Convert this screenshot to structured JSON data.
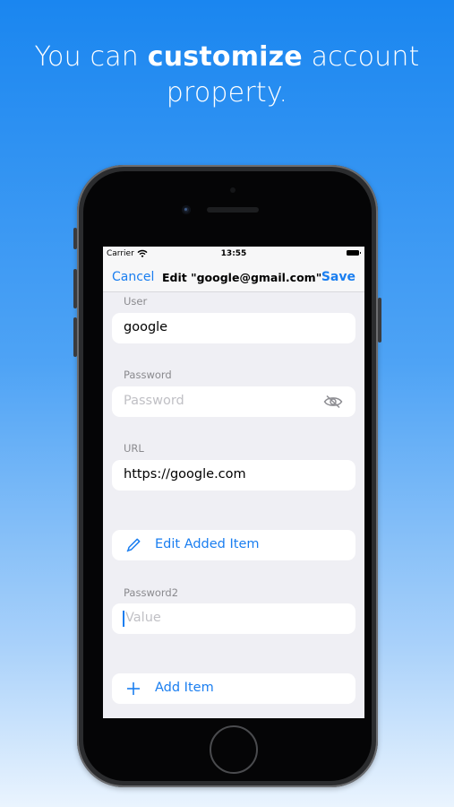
{
  "headline": {
    "prefix": "You can ",
    "bold": "customize",
    "suffix": " account property."
  },
  "status": {
    "carrier": "Carrier",
    "time": "13:55"
  },
  "nav": {
    "cancel": "Cancel",
    "title": "Edit \"google@gmail.com\"",
    "save": "Save"
  },
  "form": {
    "user_label": "User",
    "user_value": "google",
    "password_label": "Password",
    "password_placeholder": "Password",
    "url_label": "URL",
    "url_value": "https://google.com",
    "edit_added_item": "Edit Added Item",
    "password2_label": "Password2",
    "password2_placeholder": "Value",
    "add_item": "Add Item"
  },
  "icons": {
    "wifi": "wifi-icon",
    "battery": "battery-icon",
    "eye": "eye-slash-icon",
    "pencil": "pencil-icon",
    "plus": "plus-icon"
  },
  "colors": {
    "accent": "#1a7ef0",
    "background_top": "#1a86f0",
    "screen_bg": "#efeff4"
  }
}
